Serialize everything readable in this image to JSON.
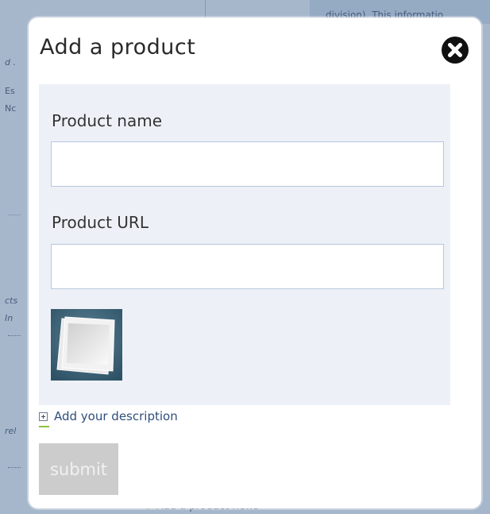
{
  "background": {
    "top_right_text": "division). This informatio",
    "side_fragments": [
      "d .",
      "Es",
      "Nc",
      "cts",
      "In",
      "rel"
    ],
    "bottom_link": "Add a product news"
  },
  "dialog": {
    "title": "Add a product",
    "close_icon": "close-x-circle-icon",
    "fields": {
      "product_name": {
        "label": "Product name",
        "value": "",
        "placeholder": ""
      },
      "product_url": {
        "label": "Product URL",
        "value": "",
        "placeholder": ""
      }
    },
    "image_placeholder_icon": "image-placeholder-icon",
    "add_description_label": "Add your description",
    "submit_label": "submit"
  },
  "colors": {
    "overlay": "#3c5f8c",
    "panel_bg": "#edf1f7",
    "input_border": "#b7c7dc",
    "link_color": "#2f4f7c",
    "submit_disabled": "#cccccc",
    "accent_green": "#8fc23f"
  }
}
